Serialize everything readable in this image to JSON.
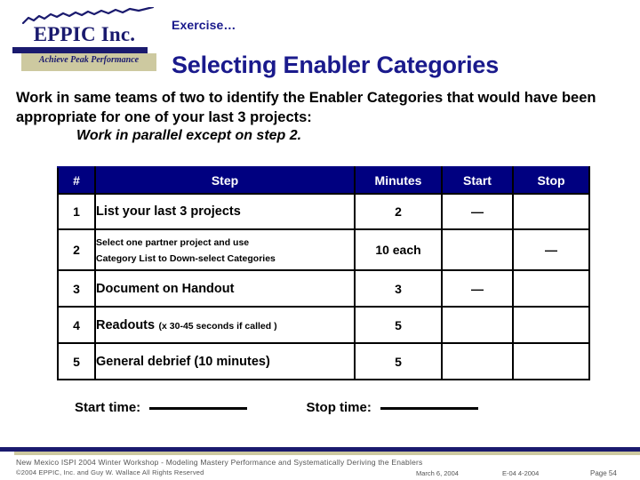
{
  "logo": {
    "wordmark": "EPPIC Inc.",
    "tagline": "Achieve Peak Performance",
    "navy": "#1a1a6e",
    "tan": "#cdc9a0"
  },
  "header": {
    "kicker": "Exercise…",
    "title": "Selecting Enabler Categories",
    "title_color": "#1a1a8c"
  },
  "intro": {
    "paragraph": "Work in same teams of two to identify the Enabler Categories that would have been appropriate for one of your last 3 projects:",
    "sub_note": "Work in parallel except on step 2."
  },
  "table": {
    "header_bg": "#000080",
    "columns": [
      "#",
      "Step",
      "Minutes",
      "Start",
      "Stop"
    ],
    "rows": [
      {
        "num": "1",
        "step_main": "List your last 3 projects",
        "step_sub": "",
        "step_paren": "",
        "minutes": "2",
        "start": "—",
        "stop": ""
      },
      {
        "num": "2",
        "step_main": "",
        "step_sub": "Select one partner project and use\nCategory List to Down-select Categories",
        "step_paren": "",
        "minutes": "10 each",
        "start": "",
        "stop": "—"
      },
      {
        "num": "3",
        "step_main": "Document on Handout",
        "step_sub": "",
        "step_paren": "",
        "minutes": "3",
        "start": "—",
        "stop": ""
      },
      {
        "num": "4",
        "step_main": "Readouts",
        "step_sub": "",
        "step_paren": "(x 30-45 seconds if called )",
        "minutes": "5",
        "start": "",
        "stop": ""
      },
      {
        "num": "5",
        "step_main": "General debrief  (10 minutes)",
        "step_sub": "",
        "step_paren": "",
        "minutes": "5",
        "start": "",
        "stop": ""
      }
    ]
  },
  "timing": {
    "start_label": "Start time:",
    "stop_label": "Stop time:"
  },
  "footer": {
    "line1": "New Mexico ISPI 2004 Winter Workshop  -  Modeling Mastery Performance and Systematically Deriving the Enablers",
    "line2": "©2004 EPPIC, Inc. and Guy W. Wallace   All Rights Reserved",
    "date": "March 6, 2004",
    "code": "E-04  4-2004",
    "page": "Page 54"
  }
}
